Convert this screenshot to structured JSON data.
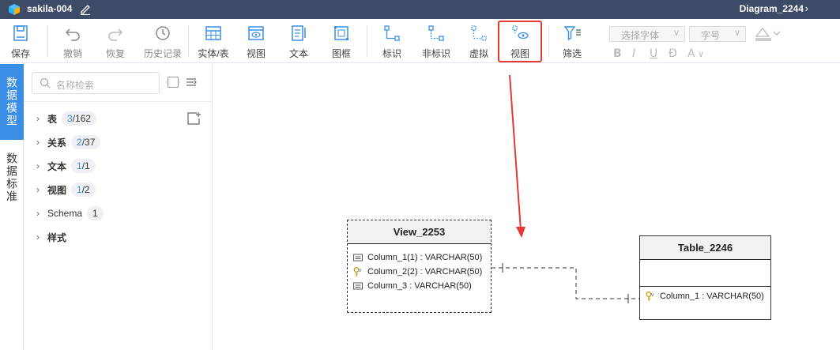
{
  "titlebar": {
    "project_name": "sakila-004",
    "diagram_name": "Diagram_2244"
  },
  "toolbar": {
    "save": "保存",
    "undo": "撤销",
    "redo": "恢复",
    "history": "历史记录",
    "entity_table": "实体/表",
    "view": "视图",
    "text": "文本",
    "frame": "图框",
    "identifying": "标识",
    "non_identifying": "非标识",
    "virtual": "虚拟",
    "view_relation": "视图",
    "filter": "筛选",
    "font_select": "选择字体",
    "font_size": "字号",
    "bold": "B",
    "italic": "I",
    "underline": "U",
    "strike": "Đ",
    "font_color": "A"
  },
  "vtabs": {
    "data_model": "数据模型",
    "data_standard": "数据标准"
  },
  "sidebar": {
    "search_placeholder": "名称检索",
    "items": [
      {
        "name": "表",
        "selected": "3",
        "total": "/162"
      },
      {
        "name": "关系",
        "selected": "2",
        "total": "/37"
      },
      {
        "name": "文本",
        "selected": "1",
        "total": "/1"
      },
      {
        "name": "视图",
        "selected": "1",
        "total": "/2"
      },
      {
        "name": "Schema",
        "selected": "",
        "total": "1"
      },
      {
        "name": "样式",
        "selected": "",
        "total": ""
      }
    ]
  },
  "canvas": {
    "view_entity": {
      "title": "View_2253",
      "columns": [
        {
          "text": "Column_1(1) : VARCHAR(50)",
          "icon": "column-icon"
        },
        {
          "text": "Column_2(2) : VARCHAR(50)",
          "icon": "key-icon"
        },
        {
          "text": "Column_3 : VARCHAR(50)",
          "icon": "column-icon"
        }
      ]
    },
    "table_entity": {
      "title": "Table_2246",
      "columns": [
        {
          "text": "Column_1 : VARCHAR(50)",
          "icon": "key-icon"
        }
      ]
    }
  },
  "colors": {
    "titlebar_bg": "#3d4b66",
    "accent": "#3a8ee6",
    "highlight_red": "#e53935"
  }
}
